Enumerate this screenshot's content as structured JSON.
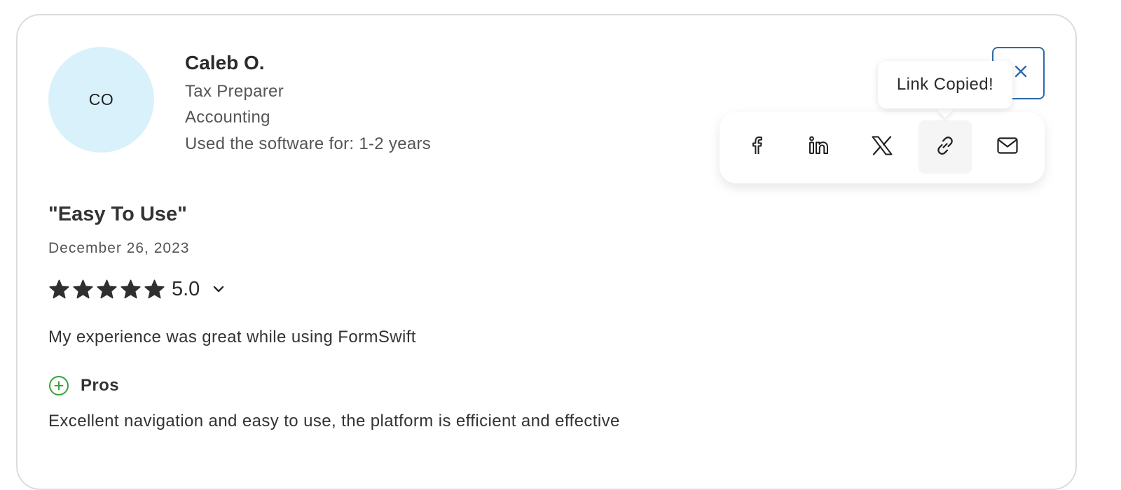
{
  "reviewer": {
    "initials": "CO",
    "name": "Caleb O.",
    "role": "Tax Preparer",
    "industry": "Accounting",
    "usage": "Used the software for: 1-2 years",
    "avatar_color": "#d9f1fb"
  },
  "share": {
    "tooltip": "Link Copied!",
    "icons": [
      "facebook-icon",
      "linkedin-icon",
      "x-icon",
      "link-icon",
      "mail-icon"
    ],
    "active_icon": "link-icon",
    "close_icon": "close-icon",
    "accent_color": "#2d6aa8"
  },
  "review": {
    "title": "\"Easy To Use\"",
    "date": "December 26, 2023",
    "rating": "5.0",
    "stars": 5,
    "summary": "My experience was great while using FormSwift",
    "pros_label": "Pros",
    "pros_text": "Excellent navigation and easy to use, the platform is efficient and effective",
    "pros_color": "#3aa13a"
  }
}
